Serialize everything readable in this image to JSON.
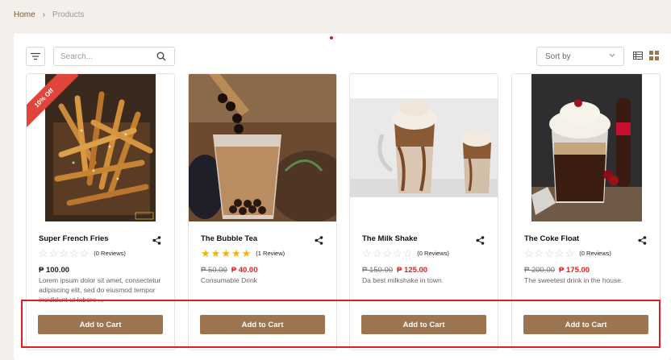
{
  "breadcrumb": {
    "home": "Home",
    "separator": "›",
    "current": "Products"
  },
  "toolbar": {
    "search_placeholder": "Search...",
    "sort_label": "Sort by"
  },
  "products": [
    {
      "name": "Super French Fries",
      "rating": 0,
      "reviews": "(0 Reviews)",
      "price_old": "",
      "price": "₱ 100.00",
      "description": "Lorem ipsum dolor sit amet, consectetur adipiscing elit, sed do eiusmod tempor incididunt ut labore ...",
      "badge": "10% Off",
      "button": "Add to Cart"
    },
    {
      "name": "The Bubble Tea",
      "rating": 5,
      "reviews": "(1 Review)",
      "price_old": "₱ 50.00",
      "price": "₱ 40.00",
      "description": "Consumable Drink",
      "badge": "",
      "button": "Add to Cart"
    },
    {
      "name": "The Milk Shake",
      "rating": 0,
      "reviews": "(0 Reviews)",
      "price_old": "₱ 150.00",
      "price": "₱ 125.00",
      "description": "Da best milkshake in town.",
      "badge": "",
      "button": "Add to Cart"
    },
    {
      "name": "The Coke Float",
      "rating": 0,
      "reviews": "(0 Reviews)",
      "price_old": "₱ 200.00",
      "price": "₱ 175.00",
      "description": "The sweetest drink in the house.",
      "badge": "",
      "button": "Add to Cart"
    }
  ],
  "colors": {
    "accent": "#9c7550",
    "sale": "#e21f1f",
    "badge": "#e0443a",
    "star": "#f5b400",
    "highlight": "#e02020"
  }
}
